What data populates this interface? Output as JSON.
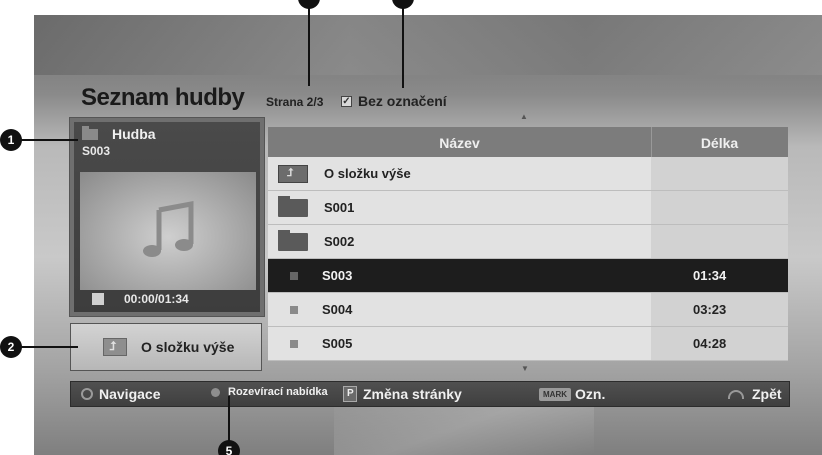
{
  "header": {
    "title": "Seznam hudby",
    "page_indicator": "Strana 2/3",
    "unmark_label": "Bez označení"
  },
  "preview": {
    "folder_label": "Hudba",
    "track": "S003",
    "time": "00:00/01:34"
  },
  "up_folder_button": "O složku výše",
  "list": {
    "col_name": "Název",
    "col_duration": "Délka",
    "rows": [
      {
        "type": "folder-up",
        "name": "O složku výše",
        "duration": ""
      },
      {
        "type": "folder",
        "name": "S001",
        "duration": ""
      },
      {
        "type": "folder",
        "name": "S002",
        "duration": ""
      },
      {
        "type": "music",
        "name": "S003",
        "duration": "01:34",
        "selected": true
      },
      {
        "type": "music",
        "name": "S004",
        "duration": "03:23"
      },
      {
        "type": "music",
        "name": "S005",
        "duration": "04:28"
      }
    ]
  },
  "bottom_bar": {
    "navigate": "Navigace",
    "popup": "Rozevírací nabídka",
    "page_change": "Změna stránky",
    "mark_key": "MARK",
    "mark": "Ozn.",
    "back": "Zpět"
  },
  "callouts": {
    "c1": "1",
    "c2": "2",
    "c5": "5"
  },
  "colors": {
    "selected_row": "#1d1d1d",
    "row_bg": "#e2e2e2",
    "header_bg": "#7c7c7c",
    "bar_bg": "#454545"
  }
}
